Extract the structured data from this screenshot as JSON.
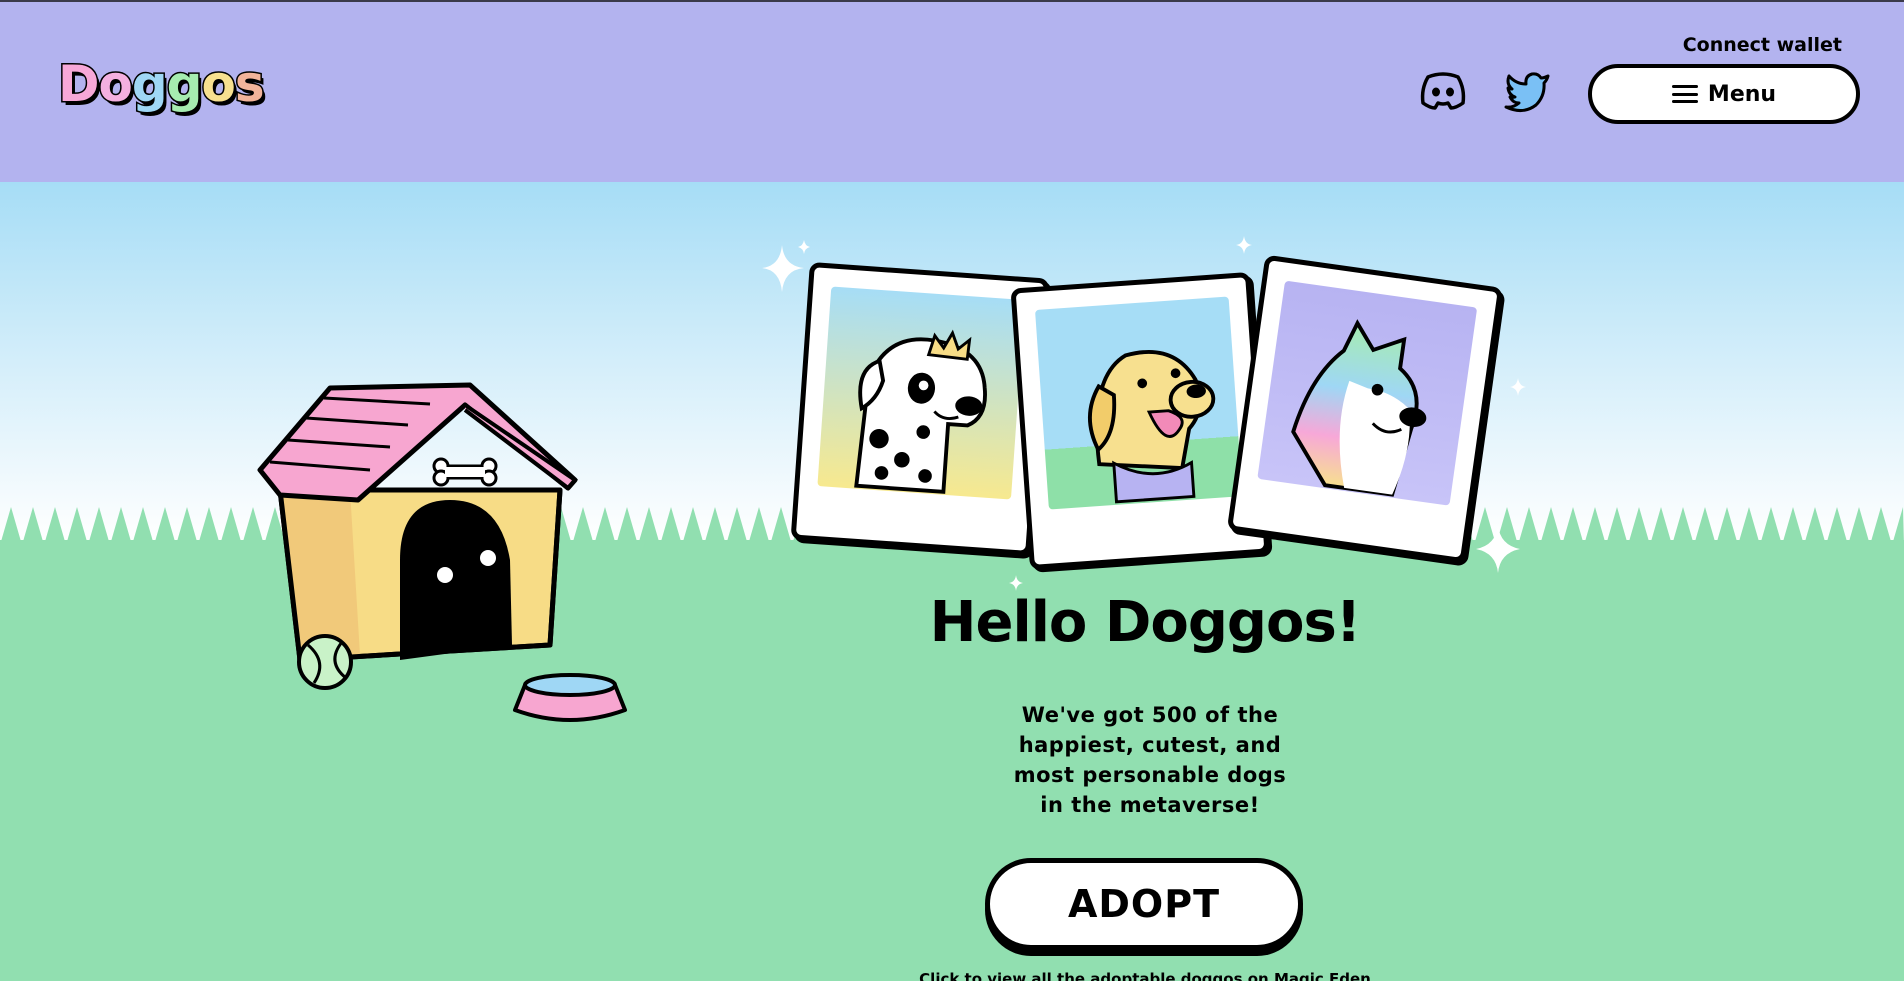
{
  "header": {
    "logo": "Doggos",
    "connect_wallet": "Connect wallet",
    "menu_label": "Menu",
    "social": [
      "discord-icon",
      "twitter-icon"
    ]
  },
  "hero": {
    "title": "Hello Doggos!",
    "subtitle_lines": [
      "We've got 500 of the",
      "happiest, cutest, and",
      "most personable dogs",
      "in the metaverse!"
    ],
    "adopt_label": "ADOPT",
    "footnote": "Click to view all the adoptable doggos on Magic Eden"
  },
  "colors": {
    "header_bg": "#b3b3ef",
    "grass": "#91dfb0",
    "sky_top": "#a6ddf6",
    "logo_letters": [
      "#f7a8d8",
      "#9fd7f5",
      "#a6ecb0",
      "#f7e08f",
      "#f7b8a0",
      "#e8b090"
    ]
  }
}
